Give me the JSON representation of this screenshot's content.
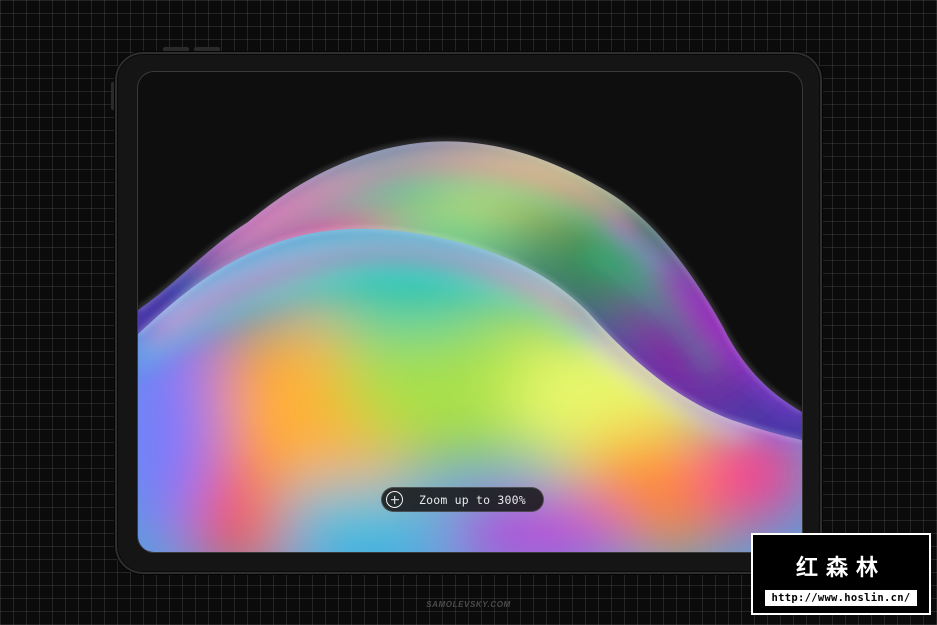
{
  "zoom_hint": {
    "icon": "plus-circle-icon",
    "label": "Zoom up to 300%"
  },
  "credit": "SAMOLEVSKY.COM",
  "watermark": {
    "title": "红森林",
    "url": "http://www.hoslin.cn/"
  },
  "colors": {
    "background": "#0b0b0b",
    "device_frame": "#151515",
    "screen": "#0e0e0e"
  }
}
